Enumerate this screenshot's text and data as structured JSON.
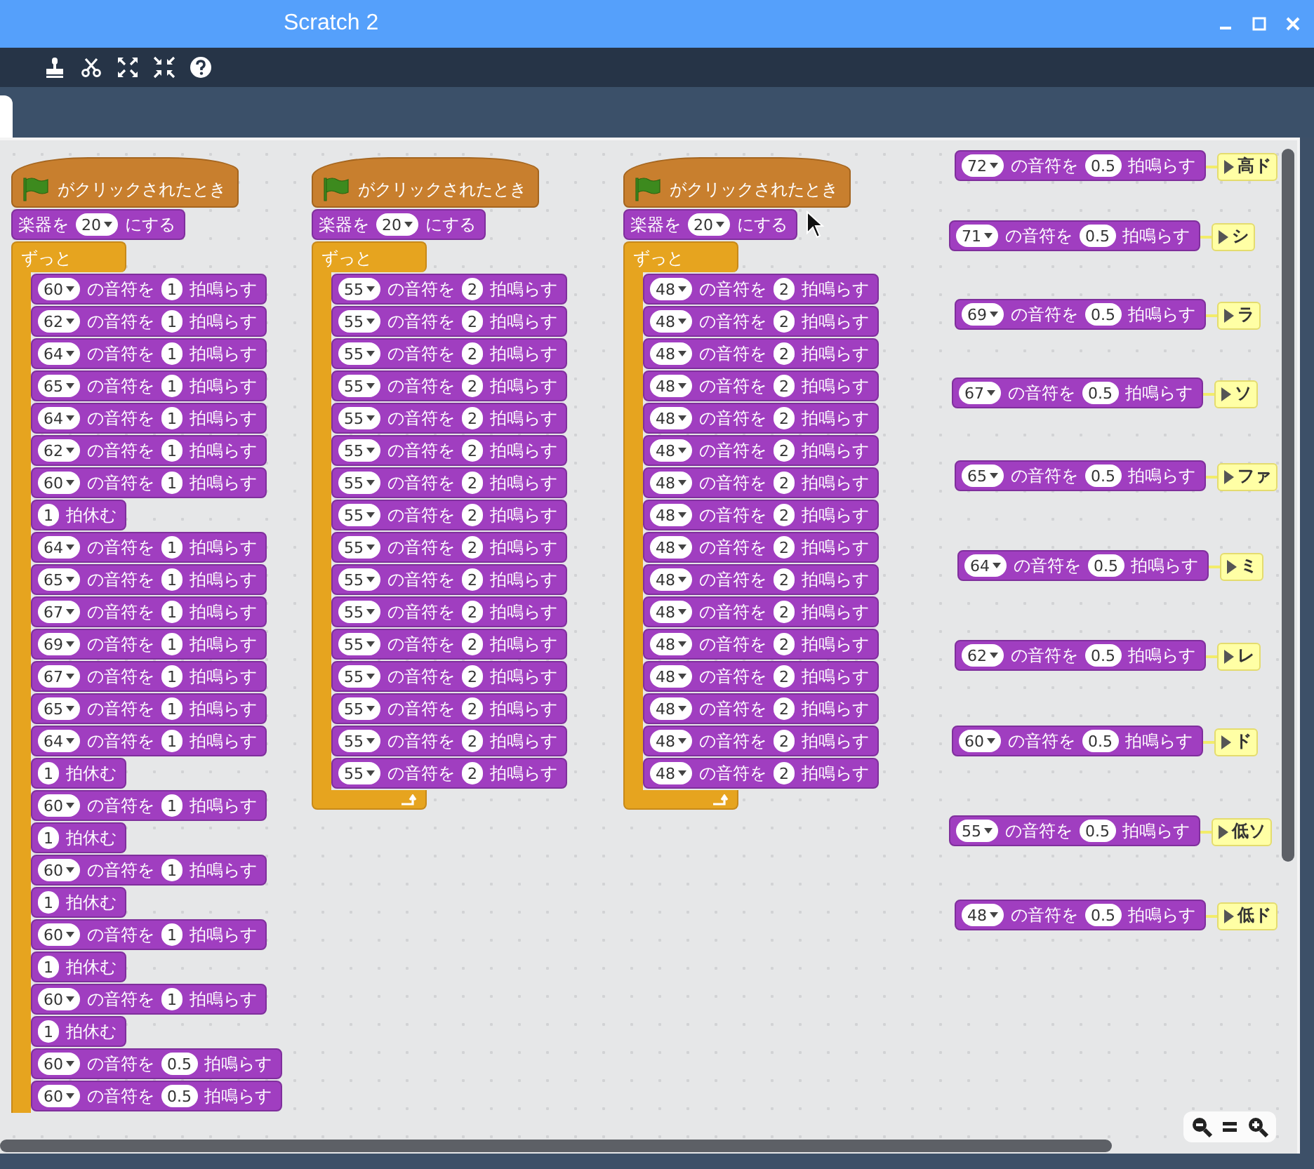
{
  "window": {
    "title": "Scratch 2"
  },
  "scripts": [
    {
      "hat": "がクリックされたとき",
      "instrument": {
        "label": "楽器を",
        "value": "20",
        "label2": "にする"
      },
      "loop": "ずっと",
      "loop_end_shown": false,
      "blocks": [
        {
          "kind": "note",
          "note": "60",
          "label": "の音符を",
          "beats": "1",
          "label2": "拍鳴らす"
        },
        {
          "kind": "note",
          "note": "62",
          "label": "の音符を",
          "beats": "1",
          "label2": "拍鳴らす"
        },
        {
          "kind": "note",
          "note": "64",
          "label": "の音符を",
          "beats": "1",
          "label2": "拍鳴らす"
        },
        {
          "kind": "note",
          "note": "65",
          "label": "の音符を",
          "beats": "1",
          "label2": "拍鳴らす"
        },
        {
          "kind": "note",
          "note": "64",
          "label": "の音符を",
          "beats": "1",
          "label2": "拍鳴らす"
        },
        {
          "kind": "note",
          "note": "62",
          "label": "の音符を",
          "beats": "1",
          "label2": "拍鳴らす"
        },
        {
          "kind": "note",
          "note": "60",
          "label": "の音符を",
          "beats": "1",
          "label2": "拍鳴らす"
        },
        {
          "kind": "rest",
          "beats": "1",
          "label": "拍休む"
        },
        {
          "kind": "note",
          "note": "64",
          "label": "の音符を",
          "beats": "1",
          "label2": "拍鳴らす"
        },
        {
          "kind": "note",
          "note": "65",
          "label": "の音符を",
          "beats": "1",
          "label2": "拍鳴らす"
        },
        {
          "kind": "note",
          "note": "67",
          "label": "の音符を",
          "beats": "1",
          "label2": "拍鳴らす"
        },
        {
          "kind": "note",
          "note": "69",
          "label": "の音符を",
          "beats": "1",
          "label2": "拍鳴らす"
        },
        {
          "kind": "note",
          "note": "67",
          "label": "の音符を",
          "beats": "1",
          "label2": "拍鳴らす"
        },
        {
          "kind": "note",
          "note": "65",
          "label": "の音符を",
          "beats": "1",
          "label2": "拍鳴らす"
        },
        {
          "kind": "note",
          "note": "64",
          "label": "の音符を",
          "beats": "1",
          "label2": "拍鳴らす"
        },
        {
          "kind": "rest",
          "beats": "1",
          "label": "拍休む"
        },
        {
          "kind": "note",
          "note": "60",
          "label": "の音符を",
          "beats": "1",
          "label2": "拍鳴らす"
        },
        {
          "kind": "rest",
          "beats": "1",
          "label": "拍休む"
        },
        {
          "kind": "note",
          "note": "60",
          "label": "の音符を",
          "beats": "1",
          "label2": "拍鳴らす"
        },
        {
          "kind": "rest",
          "beats": "1",
          "label": "拍休む"
        },
        {
          "kind": "note",
          "note": "60",
          "label": "の音符を",
          "beats": "1",
          "label2": "拍鳴らす"
        },
        {
          "kind": "rest",
          "beats": "1",
          "label": "拍休む"
        },
        {
          "kind": "note",
          "note": "60",
          "label": "の音符を",
          "beats": "1",
          "label2": "拍鳴らす"
        },
        {
          "kind": "rest",
          "beats": "1",
          "label": "拍休む"
        },
        {
          "kind": "note",
          "note": "60",
          "label": "の音符を",
          "beats": "0.5",
          "label2": "拍鳴らす"
        },
        {
          "kind": "note",
          "note": "60",
          "label": "の音符を",
          "beats": "0.5",
          "label2": "拍鳴らす"
        }
      ]
    },
    {
      "hat": "がクリックされたとき",
      "instrument": {
        "label": "楽器を",
        "value": "20",
        "label2": "にする"
      },
      "loop": "ずっと",
      "loop_end_shown": true,
      "blocks": [
        {
          "kind": "note",
          "note": "55",
          "label": "の音符を",
          "beats": "2",
          "label2": "拍鳴らす"
        },
        {
          "kind": "note",
          "note": "55",
          "label": "の音符を",
          "beats": "2",
          "label2": "拍鳴らす"
        },
        {
          "kind": "note",
          "note": "55",
          "label": "の音符を",
          "beats": "2",
          "label2": "拍鳴らす"
        },
        {
          "kind": "note",
          "note": "55",
          "label": "の音符を",
          "beats": "2",
          "label2": "拍鳴らす"
        },
        {
          "kind": "note",
          "note": "55",
          "label": "の音符を",
          "beats": "2",
          "label2": "拍鳴らす"
        },
        {
          "kind": "note",
          "note": "55",
          "label": "の音符を",
          "beats": "2",
          "label2": "拍鳴らす"
        },
        {
          "kind": "note",
          "note": "55",
          "label": "の音符を",
          "beats": "2",
          "label2": "拍鳴らす"
        },
        {
          "kind": "note",
          "note": "55",
          "label": "の音符を",
          "beats": "2",
          "label2": "拍鳴らす"
        },
        {
          "kind": "note",
          "note": "55",
          "label": "の音符を",
          "beats": "2",
          "label2": "拍鳴らす"
        },
        {
          "kind": "note",
          "note": "55",
          "label": "の音符を",
          "beats": "2",
          "label2": "拍鳴らす"
        },
        {
          "kind": "note",
          "note": "55",
          "label": "の音符を",
          "beats": "2",
          "label2": "拍鳴らす"
        },
        {
          "kind": "note",
          "note": "55",
          "label": "の音符を",
          "beats": "2",
          "label2": "拍鳴らす"
        },
        {
          "kind": "note",
          "note": "55",
          "label": "の音符を",
          "beats": "2",
          "label2": "拍鳴らす"
        },
        {
          "kind": "note",
          "note": "55",
          "label": "の音符を",
          "beats": "2",
          "label2": "拍鳴らす"
        },
        {
          "kind": "note",
          "note": "55",
          "label": "の音符を",
          "beats": "2",
          "label2": "拍鳴らす"
        },
        {
          "kind": "note",
          "note": "55",
          "label": "の音符を",
          "beats": "2",
          "label2": "拍鳴らす"
        }
      ]
    },
    {
      "hat": "がクリックされたとき",
      "instrument": {
        "label": "楽器を",
        "value": "20",
        "label2": "にする"
      },
      "loop": "ずっと",
      "loop_end_shown": true,
      "blocks": [
        {
          "kind": "note",
          "note": "48",
          "label": "の音符を",
          "beats": "2",
          "label2": "拍鳴らす"
        },
        {
          "kind": "note",
          "note": "48",
          "label": "の音符を",
          "beats": "2",
          "label2": "拍鳴らす"
        },
        {
          "kind": "note",
          "note": "48",
          "label": "の音符を",
          "beats": "2",
          "label2": "拍鳴らす"
        },
        {
          "kind": "note",
          "note": "48",
          "label": "の音符を",
          "beats": "2",
          "label2": "拍鳴らす"
        },
        {
          "kind": "note",
          "note": "48",
          "label": "の音符を",
          "beats": "2",
          "label2": "拍鳴らす"
        },
        {
          "kind": "note",
          "note": "48",
          "label": "の音符を",
          "beats": "2",
          "label2": "拍鳴らす"
        },
        {
          "kind": "note",
          "note": "48",
          "label": "の音符を",
          "beats": "2",
          "label2": "拍鳴らす"
        },
        {
          "kind": "note",
          "note": "48",
          "label": "の音符を",
          "beats": "2",
          "label2": "拍鳴らす"
        },
        {
          "kind": "note",
          "note": "48",
          "label": "の音符を",
          "beats": "2",
          "label2": "拍鳴らす"
        },
        {
          "kind": "note",
          "note": "48",
          "label": "の音符を",
          "beats": "2",
          "label2": "拍鳴らす"
        },
        {
          "kind": "note",
          "note": "48",
          "label": "の音符を",
          "beats": "2",
          "label2": "拍鳴らす"
        },
        {
          "kind": "note",
          "note": "48",
          "label": "の音符を",
          "beats": "2",
          "label2": "拍鳴らす"
        },
        {
          "kind": "note",
          "note": "48",
          "label": "の音符を",
          "beats": "2",
          "label2": "拍鳴らす"
        },
        {
          "kind": "note",
          "note": "48",
          "label": "の音符を",
          "beats": "2",
          "label2": "拍鳴らす"
        },
        {
          "kind": "note",
          "note": "48",
          "label": "の音符を",
          "beats": "2",
          "label2": "拍鳴らす"
        },
        {
          "kind": "note",
          "note": "48",
          "label": "の音符を",
          "beats": "2",
          "label2": "拍鳴らす"
        }
      ]
    }
  ],
  "loose_blocks": [
    {
      "note": "72",
      "label": "の音符を",
      "beats": "0.5",
      "label2": "拍鳴らす",
      "comment": "高ド"
    },
    {
      "note": "71",
      "label": "の音符を",
      "beats": "0.5",
      "label2": "拍鳴らす",
      "comment": "シ"
    },
    {
      "note": "69",
      "label": "の音符を",
      "beats": "0.5",
      "label2": "拍鳴らす",
      "comment": "ラ"
    },
    {
      "note": "67",
      "label": "の音符を",
      "beats": "0.5",
      "label2": "拍鳴らす",
      "comment": "ソ"
    },
    {
      "note": "65",
      "label": "の音符を",
      "beats": "0.5",
      "label2": "拍鳴らす",
      "comment": "ファ"
    },
    {
      "note": "64",
      "label": "の音符を",
      "beats": "0.5",
      "label2": "拍鳴らす",
      "comment": "ミ"
    },
    {
      "note": "62",
      "label": "の音符を",
      "beats": "0.5",
      "label2": "拍鳴らす",
      "comment": "レ"
    },
    {
      "note": "60",
      "label": "の音符を",
      "beats": "0.5",
      "label2": "拍鳴らす",
      "comment": "ド"
    },
    {
      "note": "55",
      "label": "の音符を",
      "beats": "0.5",
      "label2": "拍鳴らす",
      "comment": "低ソ"
    },
    {
      "note": "48",
      "label": "の音符を",
      "beats": "0.5",
      "label2": "拍鳴らす",
      "comment": "低ド"
    }
  ]
}
